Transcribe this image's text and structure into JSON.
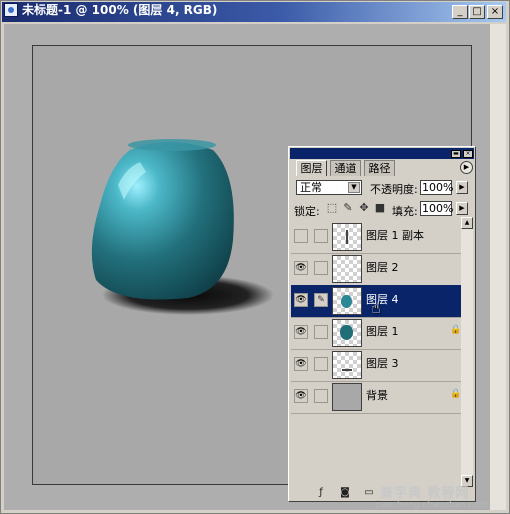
{
  "window": {
    "title": "未标题-1 @ 100% (图层 4, RGB)",
    "buttons": {
      "minimize": "_",
      "maximize": "□",
      "close": "×"
    }
  },
  "layers_panel": {
    "tabs": [
      {
        "label": "图层",
        "active": true
      },
      {
        "label": "通道",
        "active": false
      },
      {
        "label": "路径",
        "active": false
      }
    ],
    "blend_mode": "正常",
    "opacity_label": "不透明度:",
    "opacity_value": "100%",
    "lock_label": "锁定:",
    "fill_label": "填充:",
    "fill_value": "100%",
    "layers": [
      {
        "name": "图层 1 副本",
        "visible": false,
        "selected": false,
        "thumbnail": "vertical-line"
      },
      {
        "name": "图层 2",
        "visible": true,
        "selected": false,
        "thumbnail": "transparent"
      },
      {
        "name": "图层 4",
        "visible": true,
        "selected": true,
        "thumbnail": "teal-blob"
      },
      {
        "name": "图层 1",
        "visible": true,
        "selected": false,
        "thumbnail": "teal-blob"
      },
      {
        "name": "图层 3",
        "visible": true,
        "selected": false,
        "thumbnail": "dash"
      },
      {
        "name": "背景",
        "visible": true,
        "selected": false,
        "thumbnail": "gray"
      }
    ]
  },
  "watermark": {
    "line1": "查字典 教程网",
    "line2": "jiaocheng.chazidian.com"
  },
  "colors": {
    "title_bar": "#1a2c6e",
    "selection": "#0a246a",
    "vase_teal": "#2a8894",
    "canvas_gray": "#a8a8a8"
  }
}
